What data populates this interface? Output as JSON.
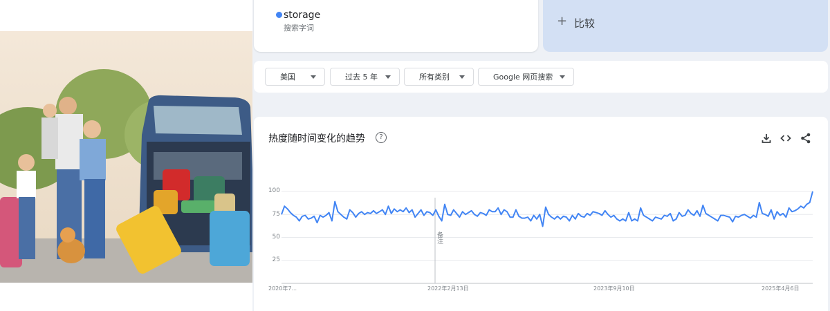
{
  "search_term": {
    "term": "storage",
    "subtitle": "搜索字词",
    "color": "#4285f4"
  },
  "compare": {
    "label": "比较",
    "plus": "+"
  },
  "filters": [
    {
      "label": "美国"
    },
    {
      "label": "过去 5 年"
    },
    {
      "label": "所有类别"
    },
    {
      "label": "Google 网页搜索"
    }
  ],
  "panel": {
    "title": "热度随时间变化的趋势",
    "help_icon": "?",
    "icons": [
      "download-icon",
      "embed-code-icon",
      "share-icon"
    ],
    "note_label": "备注"
  },
  "chart_data": {
    "type": "line",
    "x_start_label": "2020年7...",
    "x_tick_labels": [
      "2020年7...",
      "2022年2月13日",
      "2023年9月10日",
      "2025年4月6日"
    ],
    "y_ticks": [
      100,
      75,
      50,
      25
    ],
    "ylim": [
      0,
      100
    ],
    "grid": true,
    "series": [
      {
        "color": "#4285f4",
        "values": [
          75,
          84,
          81,
          77,
          74,
          72,
          68,
          73,
          74,
          70,
          71,
          73,
          66,
          74,
          72,
          74,
          77,
          68,
          89,
          78,
          75,
          72,
          70,
          80,
          77,
          72,
          76,
          78,
          75,
          77,
          76,
          79,
          76,
          78,
          80,
          75,
          84,
          76,
          81,
          78,
          80,
          78,
          82,
          77,
          80,
          72,
          76,
          80,
          74,
          78,
          77,
          74,
          80,
          73,
          68,
          86,
          75,
          74,
          80,
          76,
          72,
          78,
          75,
          77,
          79,
          75,
          73,
          77,
          76,
          74,
          80,
          78,
          78,
          82,
          75,
          80,
          78,
          72,
          72,
          80,
          73,
          71,
          71,
          72,
          68,
          74,
          70,
          75,
          62,
          83,
          75,
          72,
          70,
          73,
          70,
          73,
          72,
          68,
          74,
          70,
          76,
          73,
          72,
          76,
          74,
          78,
          77,
          76,
          74,
          79,
          75,
          72,
          74,
          70,
          68,
          70,
          68,
          77,
          68,
          70,
          68,
          82,
          74,
          72,
          70,
          68,
          72,
          71,
          70,
          74,
          73,
          76,
          68,
          70,
          77,
          73,
          74,
          80,
          76,
          74,
          79,
          73,
          85,
          76,
          74,
          72,
          70,
          68,
          74,
          74,
          73,
          72,
          67,
          73,
          72,
          74,
          75,
          73,
          71,
          74,
          72,
          88,
          76,
          75,
          73,
          80,
          70,
          78,
          74,
          76,
          72,
          82,
          78,
          79,
          81,
          84,
          82,
          86,
          88,
          100
        ]
      }
    ]
  }
}
